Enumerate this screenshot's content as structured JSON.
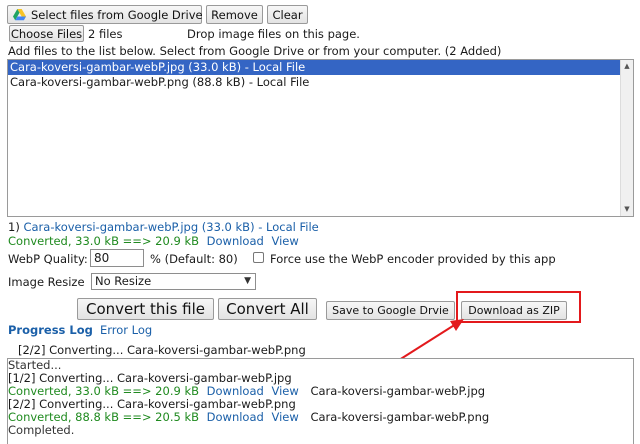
{
  "toolbar": {
    "gdrive_label": "Select files from Google Drive",
    "remove_label": "Remove",
    "clear_label": "Clear"
  },
  "file_input": {
    "button_label": "Choose Files",
    "count_text": "2 files",
    "drop_hint": "Drop image files on this page."
  },
  "file_list": {
    "instructions": "Add files to the list below. Select from Google Drive or from your computer. (2 Added)",
    "items": [
      {
        "label": "Cara-koversi-gambar-webP.jpg (33.0 kB) - Local File"
      },
      {
        "label": "Cara-koversi-gambar-webP.png (88.8 kB) - Local File"
      }
    ]
  },
  "selected_file": {
    "index": "1)",
    "name": "Cara-koversi-gambar-webP.jpg (33.0 kB) - Local File",
    "converted_text": "Converted, 33.0 kB ==> 20.9 kB",
    "download_label": "Download",
    "view_label": "View"
  },
  "options": {
    "quality_label": "WebP Quality:",
    "quality_value": "80",
    "quality_default": "% (Default: 80)",
    "force_encoder_label": "Force use the WebP encoder provided by this app",
    "resize_label": "Image Resize",
    "resize_value": "No Resize"
  },
  "actions": {
    "convert_this_label": "Convert this file",
    "convert_all_label": "Convert All",
    "save_gdrive_label": "Save to Google Drvie",
    "download_zip_label": "Download as ZIP"
  },
  "log_tabs": {
    "progress_label": "Progress Log",
    "error_label": "Error Log"
  },
  "log": {
    "current": "[2/2] Converting... Cara-koversi-gambar-webP.png",
    "lines": [
      {
        "text": "Started...",
        "type": "plain"
      },
      {
        "text": "[1/2] Converting... Cara-koversi-gambar-webP.jpg",
        "type": "plain"
      },
      {
        "text": "Converted, 33.0 kB ==> 20.9 kB",
        "type": "converted",
        "download": "Download",
        "view": "View",
        "file": "Cara-koversi-gambar-webP.jpg"
      },
      {
        "text": "[2/2] Converting... Cara-koversi-gambar-webP.png",
        "type": "plain"
      },
      {
        "text": "Converted, 88.8 kB ==> 20.5 kB",
        "type": "converted",
        "download": "Download",
        "view": "View",
        "file": "Cara-koversi-gambar-webP.png"
      },
      {
        "text": "Completed.",
        "type": "plain"
      }
    ]
  },
  "colors": {
    "selection": "#3465c4",
    "link": "#1a5fa8",
    "success": "#1f8a1f",
    "annotation": "#e3191c"
  }
}
